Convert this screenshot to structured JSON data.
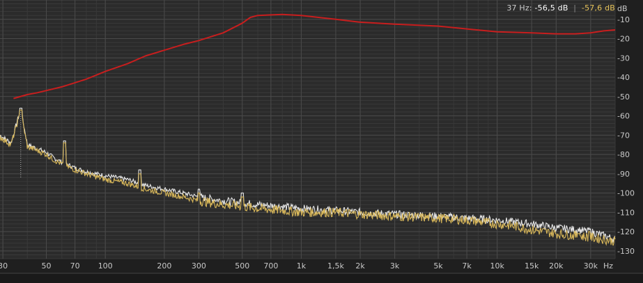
{
  "readout": {
    "freq_label": "37 Hz:",
    "value_white": "-56,5 dB",
    "separator": "|",
    "value_gold": "-57,6 dB"
  },
  "colors": {
    "background": "#2b2b2b",
    "grid": "#4a4a4a",
    "white_series": "#e6e6e6",
    "gold_series": "#d9b85a",
    "red_curve": "#c81e1e",
    "tick_text": "#c9c9c9"
  },
  "chart_data": {
    "type": "line",
    "x_scale": "log",
    "xlim": [
      29,
      40000
    ],
    "ylim": [
      -134,
      0
    ],
    "y_unit": "dB",
    "x_unit": "Hz",
    "x_ticks": [
      {
        "v": 30,
        "label": "30"
      },
      {
        "v": 50,
        "label": "50"
      },
      {
        "v": 70,
        "label": "70"
      },
      {
        "v": 100,
        "label": "100"
      },
      {
        "v": 200,
        "label": "200"
      },
      {
        "v": 300,
        "label": "300"
      },
      {
        "v": 500,
        "label": "500"
      },
      {
        "v": 700,
        "label": "700"
      },
      {
        "v": 1000,
        "label": "1k"
      },
      {
        "v": 1500,
        "label": "1,5k"
      },
      {
        "v": 2000,
        "label": "2k"
      },
      {
        "v": 3000,
        "label": "3k"
      },
      {
        "v": 5000,
        "label": "5k"
      },
      {
        "v": 7000,
        "label": "7k"
      },
      {
        "v": 10000,
        "label": "10k"
      },
      {
        "v": 15000,
        "label": "15k"
      },
      {
        "v": 20000,
        "label": "20k"
      },
      {
        "v": 30000,
        "label": "30k"
      }
    ],
    "x_unit_label": "Hz",
    "y_ticks": [
      {
        "v": 0,
        "label": "dB"
      },
      {
        "v": -10,
        "label": "-10"
      },
      {
        "v": -20,
        "label": "-20"
      },
      {
        "v": -30,
        "label": "-30"
      },
      {
        "v": -40,
        "label": "-40"
      },
      {
        "v": -50,
        "label": "-50"
      },
      {
        "v": -60,
        "label": "-60"
      },
      {
        "v": -70,
        "label": "-70"
      },
      {
        "v": -80,
        "label": "-80"
      },
      {
        "v": -90,
        "label": "-90"
      },
      {
        "v": -100,
        "label": "-100"
      },
      {
        "v": -110,
        "label": "-110"
      },
      {
        "v": -120,
        "label": "-120"
      },
      {
        "v": -130,
        "label": "-130"
      }
    ],
    "series": [
      {
        "id": "white",
        "x": [
          29,
          33,
          37,
          40,
          45,
          50,
          55,
          60,
          70,
          80,
          100,
          130,
          160,
          200,
          250,
          300,
          400,
          500,
          600,
          800,
          1000,
          1500,
          2000,
          3000,
          5000,
          7000,
          10000,
          12000,
          15000,
          20000,
          25000,
          30000,
          35000,
          40000
        ],
        "y": [
          -70,
          -74,
          -56.5,
          -75,
          -77,
          -79,
          -82,
          -84,
          -87,
          -89,
          -91,
          -93,
          -96,
          -98,
          -100,
          -102,
          -104,
          -105,
          -106,
          -107,
          -108,
          -109,
          -110,
          -111,
          -112,
          -113,
          -114,
          -115,
          -116,
          -118,
          -119,
          -120,
          -122,
          -124
        ]
      },
      {
        "id": "gold",
        "x": [
          29,
          33,
          37,
          40,
          45,
          50,
          55,
          60,
          70,
          80,
          100,
          130,
          160,
          200,
          250,
          300,
          400,
          500,
          600,
          800,
          1000,
          1500,
          2000,
          3000,
          5000,
          7000,
          10000,
          12000,
          15000,
          20000,
          25000,
          30000,
          35000,
          40000
        ],
        "y": [
          -71,
          -75,
          -57.6,
          -76,
          -78,
          -80,
          -83,
          -85,
          -88,
          -90,
          -93,
          -95,
          -98,
          -100,
          -102,
          -104,
          -106,
          -107,
          -108,
          -109,
          -110,
          -110,
          -111,
          -112,
          -113,
          -114,
          -116,
          -117,
          -119,
          -121,
          -122,
          -123,
          -124,
          -125
        ]
      },
      {
        "id": "red",
        "x": [
          34,
          40,
          45,
          60,
          80,
          100,
          130,
          160,
          200,
          250,
          300,
          400,
          500,
          550,
          600,
          800,
          1000,
          1500,
          2000,
          3000,
          5000,
          7000,
          10000,
          15000,
          20000,
          25000,
          30000,
          35000,
          40000
        ],
        "y": [
          -51,
          -49,
          -48,
          -45,
          -41,
          -37,
          -33,
          -29,
          -26,
          -23,
          -21,
          -17,
          -12,
          -9,
          -8,
          -7.5,
          -8,
          -10,
          -11.5,
          -12.5,
          -13.5,
          -15,
          -16.5,
          -17,
          -17.5,
          -17.5,
          -17,
          -16,
          -15.5
        ]
      }
    ],
    "peaks": {
      "white": [
        [
          37,
          -56
        ],
        [
          62,
          -73
        ],
        [
          150,
          -88
        ],
        [
          300,
          -98
        ],
        [
          500,
          -100
        ],
        [
          26000,
          -120
        ],
        [
          29500,
          -119
        ]
      ],
      "gold": [
        [
          37,
          -57
        ],
        [
          62,
          -74
        ],
        [
          150,
          -90
        ],
        [
          300,
          -100
        ],
        [
          500,
          -102
        ],
        [
          26000,
          -121
        ],
        [
          29500,
          -120
        ]
      ]
    }
  }
}
